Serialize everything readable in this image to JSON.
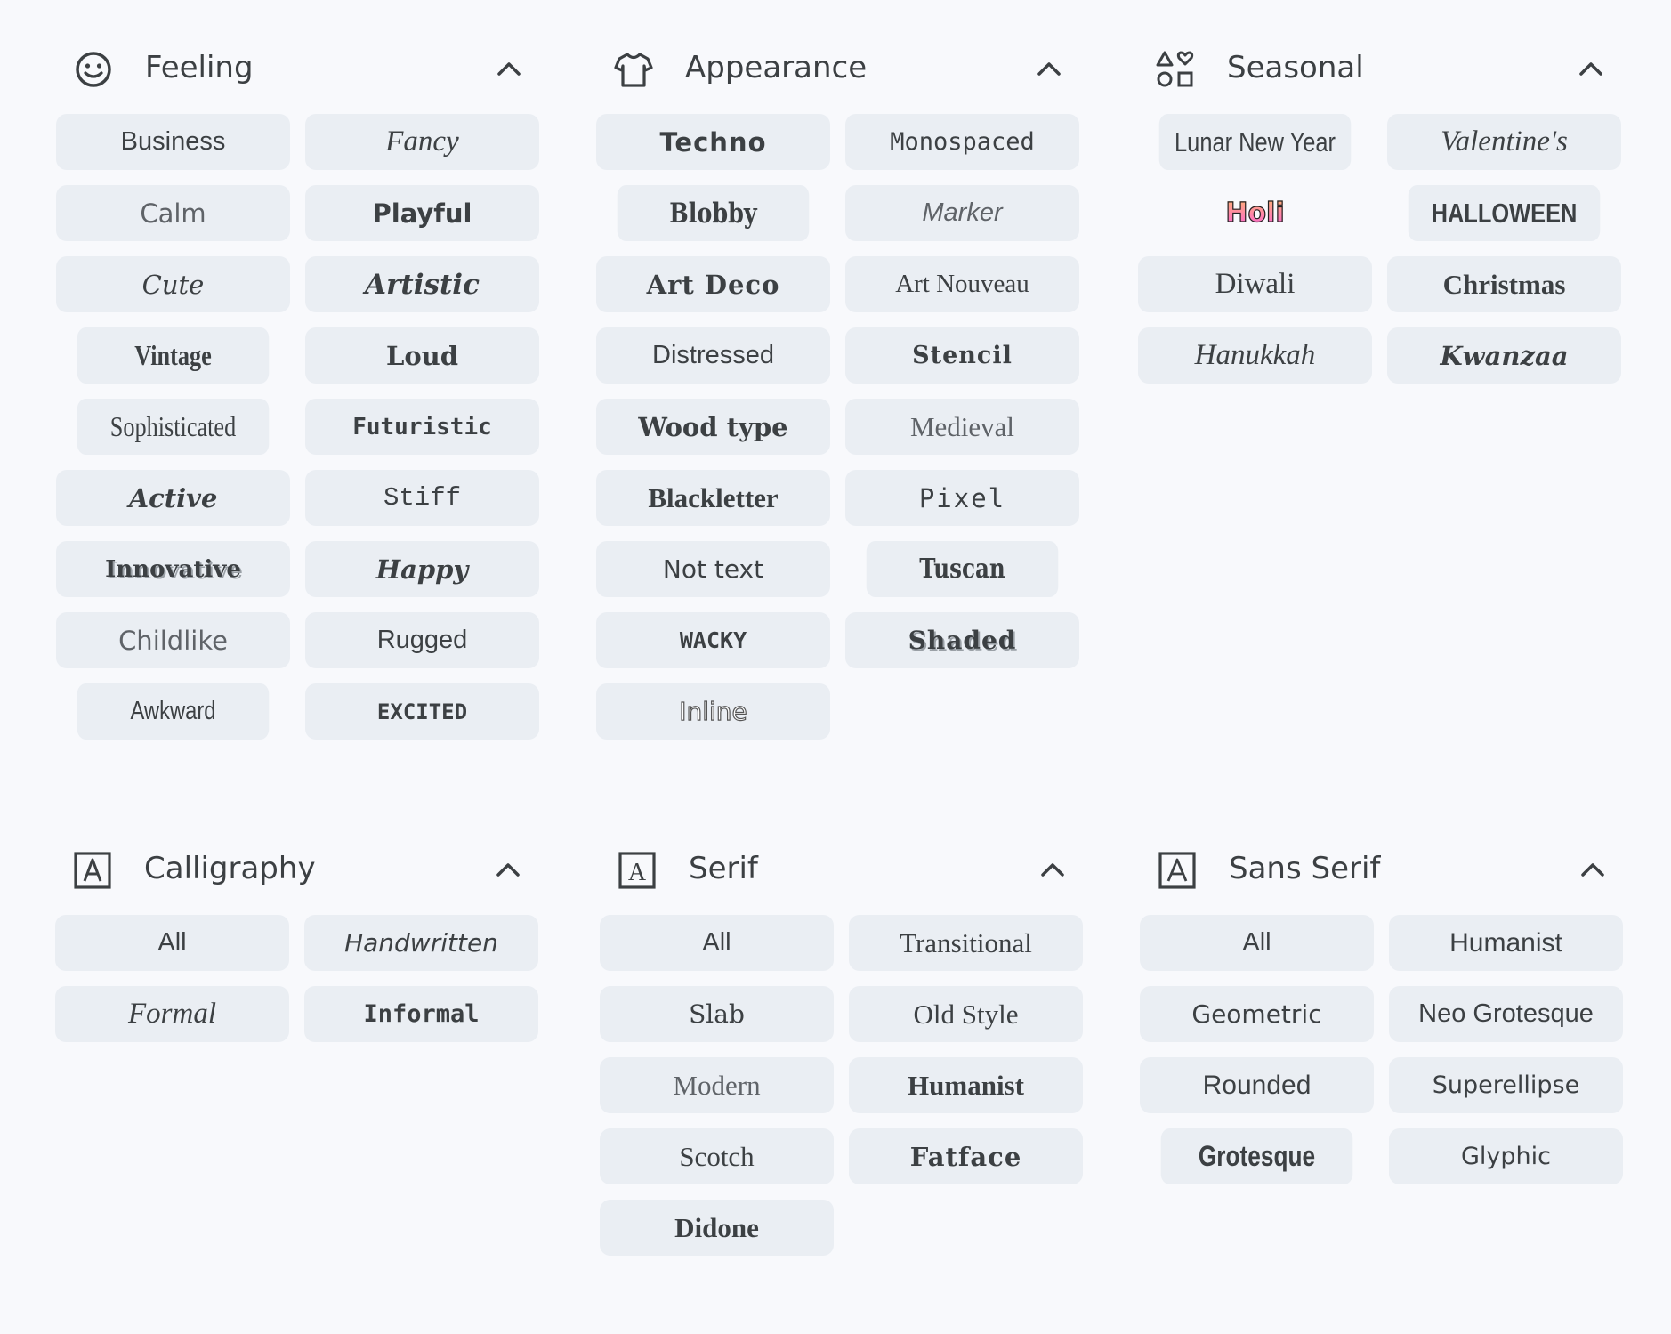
{
  "sections": {
    "feeling": {
      "title": "Feeling",
      "icon": "smiley-face-icon",
      "items": [
        "Business",
        "Fancy",
        "Calm",
        "Playful",
        "Cute",
        "Artistic",
        "Vintage",
        "Loud",
        "Sophisticated",
        "Futuristic",
        "Active",
        "Stiff",
        "Innovative",
        "Happy",
        "Childlike",
        "Rugged",
        "Awkward",
        "EXCITED"
      ]
    },
    "appearance": {
      "title": "Appearance",
      "icon": "tshirt-icon",
      "items": [
        "Techno",
        "Monospaced",
        "Blobby",
        "Marker",
        "Art Deco",
        "Art Nouveau",
        "Distressed",
        "Stencil",
        "Wood type",
        "Medieval",
        "Blackletter",
        "Pixel",
        "Not text",
        "Tuscan",
        "WACKY",
        "Shaded",
        "Inline"
      ]
    },
    "seasonal": {
      "title": "Seasonal",
      "icon": "shapes-icon",
      "items": [
        "Lunar New Year",
        "Valentine's",
        "Holi",
        "HALLOWEEN",
        "Diwali",
        "Christmas",
        "Hanukkah",
        "Kwanzaa"
      ]
    },
    "calligraphy": {
      "title": "Calligraphy",
      "icon": "calligraphy-a-icon",
      "items": [
        "All",
        "Handwritten",
        "Formal",
        "Informal"
      ]
    },
    "serif": {
      "title": "Serif",
      "icon": "serif-a-icon",
      "items": [
        "All",
        "Transitional",
        "Slab",
        "Old Style",
        "Modern",
        "Humanist",
        "Scotch",
        "Fatface",
        "Didone"
      ]
    },
    "sans_serif": {
      "title": "Sans Serif",
      "icon": "sans-serif-a-icon",
      "items": [
        "All",
        "Humanist",
        "Geometric",
        "Neo Grotesque",
        "Rounded",
        "Superellipse",
        "Grotesque",
        "Glyphic"
      ]
    }
  },
  "colors": {
    "background": "#f8f9fc",
    "chip": "#eaeef3",
    "text": "#3c4043"
  }
}
